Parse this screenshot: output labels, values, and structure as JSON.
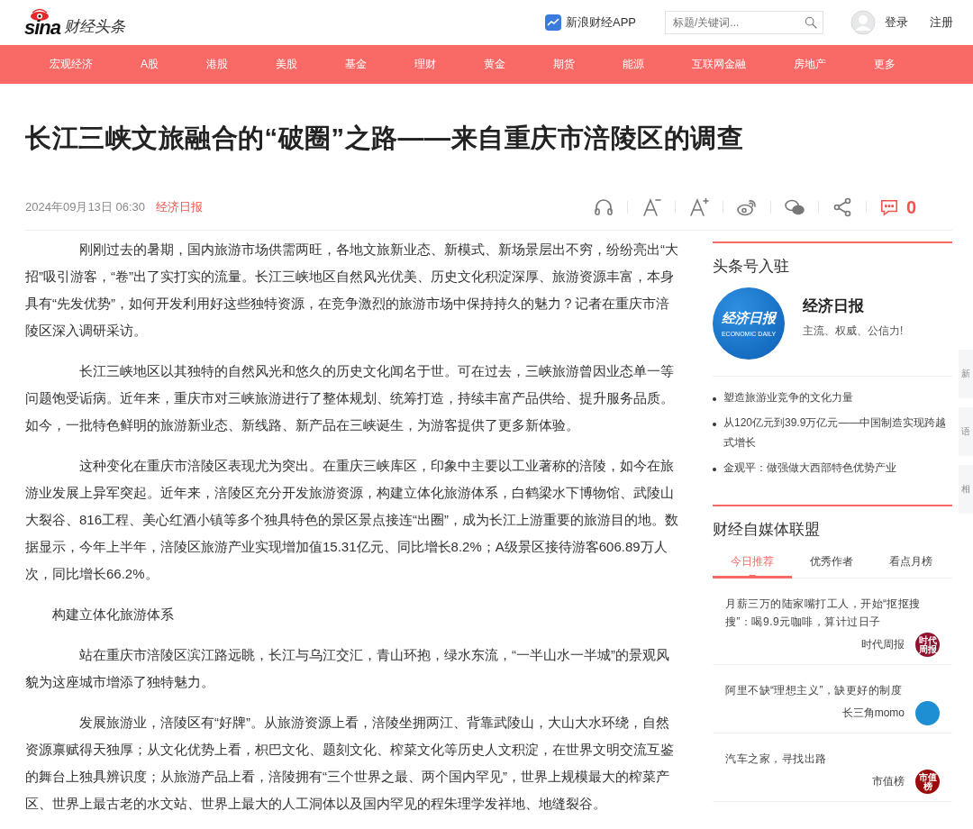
{
  "header": {
    "logo": {
      "brand": "sina",
      "product": "财经头条"
    },
    "app_link": "新浪财经APP",
    "search": {
      "placeholder": "标题/关键词..."
    },
    "login": "登录",
    "register": "注册"
  },
  "nav": [
    "宏观经济",
    "A股",
    "港股",
    "美股",
    "基金",
    "理财",
    "黄金",
    "期货",
    "能源",
    "互联网金融",
    "房地产",
    "更多"
  ],
  "article": {
    "title": "长江三峡文旅融合的“破圈”之路——来自重庆市涪陵区的调查",
    "date": "2024年09月13日 06:30",
    "source": "经济日报",
    "comment_count": "0",
    "paragraphs": [
      {
        "kind": "body",
        "text": "刚刚过去的暑期，国内旅游市场供需两旺，各地文旅新业态、新模式、新场景层出不穷，纷纷亮出“大招”吸引游客，“卷”出了实打实的流量。长江三峡地区自然风光优美、历史文化积淀深厚、旅游资源丰富，本身具有“先发优势”，如何开发利用好这些独特资源，在竞争激烈的旅游市场中保持持久的魅力？记者在重庆市涪陵区深入调研采访。"
      },
      {
        "kind": "body",
        "text": "长江三峡地区以其独特的自然风光和悠久的历史文化闻名于世。可在过去，三峡旅游曾因业态单一等问题饱受诟病。近年来，重庆市对三峡旅游进行了整体规划、统筹打造，持续丰富产品供给、提升服务品质。如今，一批特色鲜明的旅游新业态、新线路、新产品在三峡诞生，为游客提供了更多新体验。"
      },
      {
        "kind": "body",
        "text": "这种变化在重庆市涪陵区表现尤为突出。在重庆三峡库区，印象中主要以工业著称的涪陵，如今在旅游业发展上异军突起。近年来，涪陵区充分开发旅游资源，构建立体化旅游体系，白鹤梁水下博物馆、武陵山大裂谷、816工程、美心红酒小镇等多个独具特色的景区景点接连“出圈”，成为长江上游重要的旅游目的地。数据显示，今年上半年，涪陵区旅游产业实现增加值15.31亿元、同比增长8.2%；A级景区接待游客606.89万人次，同比增长66.2%。"
      },
      {
        "kind": "heading",
        "text": "构建立体化旅游体系"
      },
      {
        "kind": "body",
        "text": "站在重庆市涪陵区滨江路远眺，长江与乌江交汇，青山环抱，绿水东流，“一半山水一半城”的景观风貌为这座城市增添了独特魅力。"
      },
      {
        "kind": "body",
        "text": "发展旅游业，涪陵区有“好牌”。从旅游资源上看，涪陵坐拥两江、背靠武陵山，大山大水环绕，自然资源禀赋得天独厚；从文化优势上看，枳巴文化、题刻文化、榨菜文化等历史人文积淀，在世界文明交流互鉴的舞台上独具辨识度；从旅游产品上看，涪陵拥有“三个世界之最、两个国内罕见”，世界上规模最大的榨菜产区、世界上最古老的水文站、世界上最大的人工洞体以及国内罕见的程朱理学发祥地、地缝裂谷。"
      }
    ]
  },
  "sidebar": {
    "account": {
      "heading": "头条号入驻",
      "logo_text": "经济日报",
      "logo_subtext": "ECONOMIC DAILY",
      "name": "经济日报",
      "slogan": "主流、权威、公信力!",
      "links": [
        "塑造旅游业竞争的文化力量",
        "从120亿元到39.9万亿元——中国制造实现跨越式增长",
        "金观平：做强做大西部特色优势产业"
      ]
    },
    "alliance": {
      "heading": "财经自媒体联盟",
      "tabs": [
        {
          "label": "今日推荐",
          "selected": true
        },
        {
          "label": "优秀作者",
          "selected": false
        },
        {
          "label": "看点月榜",
          "selected": false
        }
      ],
      "items": [
        {
          "title": "月薪三万的陆家嘴打工人，开始“抠抠搜搜”：喝9.9元咖啡，算计过日子",
          "source": "时代周报",
          "avatar_text": "时代周报",
          "color": "#8e1430"
        },
        {
          "title": "阿里不缺“理想主义”，缺更好的制度",
          "source": "长三角momo",
          "color": "#1d8fd2"
        },
        {
          "title": "汽车之家，寻找出路",
          "source": "市值榜",
          "avatar_text": "市值榜",
          "color": "#9c0c0c"
        }
      ]
    }
  },
  "side_tabs": [
    "新",
    "语",
    "相"
  ]
}
